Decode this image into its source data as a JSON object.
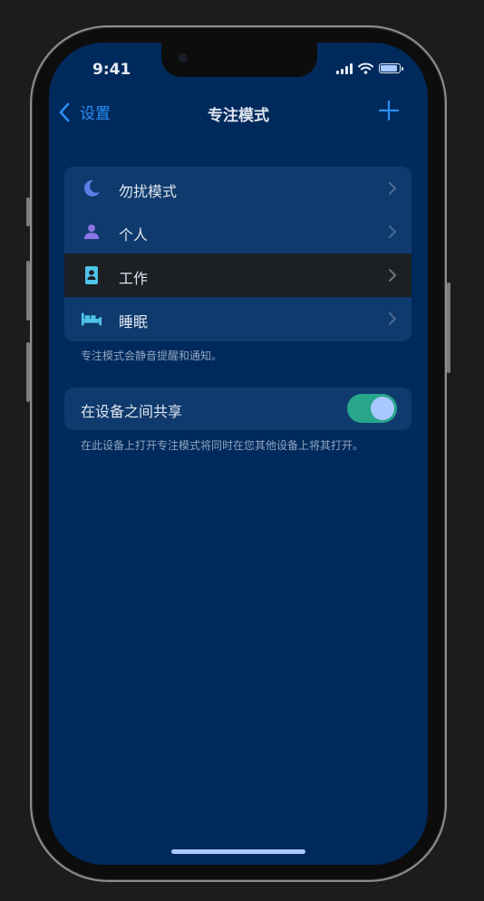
{
  "status": {
    "time": "9:41",
    "battery_level": 0.9
  },
  "nav": {
    "back_label": "设置",
    "title": "专注模式"
  },
  "focus_modes": [
    {
      "label": "勿扰模式",
      "icon": "moon-icon"
    },
    {
      "label": "个人",
      "icon": "person-icon"
    },
    {
      "label": "工作",
      "icon": "work-badge-icon",
      "highlighted": true
    },
    {
      "label": "睡眠",
      "icon": "bed-icon"
    }
  ],
  "modes_footnote": "专注模式会静音提醒和通知。",
  "share": {
    "label": "在设备之间共享",
    "enabled": true,
    "footnote": "在此设备上打开专注模式将同时在您其他设备上将其打开。"
  },
  "colors": {
    "accent": "#2a8ef5",
    "toggle_on": "#27a68c",
    "background": "#002a5c",
    "group": "#0f3a6d"
  }
}
